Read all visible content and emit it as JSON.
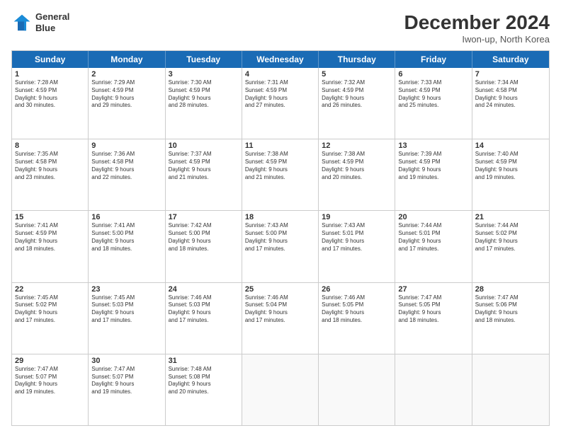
{
  "header": {
    "logo_line1": "General",
    "logo_line2": "Blue",
    "month_title": "December 2024",
    "location": "Iwon-up, North Korea"
  },
  "days_of_week": [
    "Sunday",
    "Monday",
    "Tuesday",
    "Wednesday",
    "Thursday",
    "Friday",
    "Saturday"
  ],
  "weeks": [
    [
      {
        "day": "1",
        "info": "Sunrise: 7:28 AM\nSunset: 4:59 PM\nDaylight: 9 hours\nand 30 minutes."
      },
      {
        "day": "2",
        "info": "Sunrise: 7:29 AM\nSunset: 4:59 PM\nDaylight: 9 hours\nand 29 minutes."
      },
      {
        "day": "3",
        "info": "Sunrise: 7:30 AM\nSunset: 4:59 PM\nDaylight: 9 hours\nand 28 minutes."
      },
      {
        "day": "4",
        "info": "Sunrise: 7:31 AM\nSunset: 4:59 PM\nDaylight: 9 hours\nand 27 minutes."
      },
      {
        "day": "5",
        "info": "Sunrise: 7:32 AM\nSunset: 4:59 PM\nDaylight: 9 hours\nand 26 minutes."
      },
      {
        "day": "6",
        "info": "Sunrise: 7:33 AM\nSunset: 4:59 PM\nDaylight: 9 hours\nand 25 minutes."
      },
      {
        "day": "7",
        "info": "Sunrise: 7:34 AM\nSunset: 4:58 PM\nDaylight: 9 hours\nand 24 minutes."
      }
    ],
    [
      {
        "day": "8",
        "info": "Sunrise: 7:35 AM\nSunset: 4:58 PM\nDaylight: 9 hours\nand 23 minutes."
      },
      {
        "day": "9",
        "info": "Sunrise: 7:36 AM\nSunset: 4:58 PM\nDaylight: 9 hours\nand 22 minutes."
      },
      {
        "day": "10",
        "info": "Sunrise: 7:37 AM\nSunset: 4:59 PM\nDaylight: 9 hours\nand 21 minutes."
      },
      {
        "day": "11",
        "info": "Sunrise: 7:38 AM\nSunset: 4:59 PM\nDaylight: 9 hours\nand 21 minutes."
      },
      {
        "day": "12",
        "info": "Sunrise: 7:38 AM\nSunset: 4:59 PM\nDaylight: 9 hours\nand 20 minutes."
      },
      {
        "day": "13",
        "info": "Sunrise: 7:39 AM\nSunset: 4:59 PM\nDaylight: 9 hours\nand 19 minutes."
      },
      {
        "day": "14",
        "info": "Sunrise: 7:40 AM\nSunset: 4:59 PM\nDaylight: 9 hours\nand 19 minutes."
      }
    ],
    [
      {
        "day": "15",
        "info": "Sunrise: 7:41 AM\nSunset: 4:59 PM\nDaylight: 9 hours\nand 18 minutes."
      },
      {
        "day": "16",
        "info": "Sunrise: 7:41 AM\nSunset: 5:00 PM\nDaylight: 9 hours\nand 18 minutes."
      },
      {
        "day": "17",
        "info": "Sunrise: 7:42 AM\nSunset: 5:00 PM\nDaylight: 9 hours\nand 18 minutes."
      },
      {
        "day": "18",
        "info": "Sunrise: 7:43 AM\nSunset: 5:00 PM\nDaylight: 9 hours\nand 17 minutes."
      },
      {
        "day": "19",
        "info": "Sunrise: 7:43 AM\nSunset: 5:01 PM\nDaylight: 9 hours\nand 17 minutes."
      },
      {
        "day": "20",
        "info": "Sunrise: 7:44 AM\nSunset: 5:01 PM\nDaylight: 9 hours\nand 17 minutes."
      },
      {
        "day": "21",
        "info": "Sunrise: 7:44 AM\nSunset: 5:02 PM\nDaylight: 9 hours\nand 17 minutes."
      }
    ],
    [
      {
        "day": "22",
        "info": "Sunrise: 7:45 AM\nSunset: 5:02 PM\nDaylight: 9 hours\nand 17 minutes."
      },
      {
        "day": "23",
        "info": "Sunrise: 7:45 AM\nSunset: 5:03 PM\nDaylight: 9 hours\nand 17 minutes."
      },
      {
        "day": "24",
        "info": "Sunrise: 7:46 AM\nSunset: 5:03 PM\nDaylight: 9 hours\nand 17 minutes."
      },
      {
        "day": "25",
        "info": "Sunrise: 7:46 AM\nSunset: 5:04 PM\nDaylight: 9 hours\nand 17 minutes."
      },
      {
        "day": "26",
        "info": "Sunrise: 7:46 AM\nSunset: 5:05 PM\nDaylight: 9 hours\nand 18 minutes."
      },
      {
        "day": "27",
        "info": "Sunrise: 7:47 AM\nSunset: 5:05 PM\nDaylight: 9 hours\nand 18 minutes."
      },
      {
        "day": "28",
        "info": "Sunrise: 7:47 AM\nSunset: 5:06 PM\nDaylight: 9 hours\nand 18 minutes."
      }
    ],
    [
      {
        "day": "29",
        "info": "Sunrise: 7:47 AM\nSunset: 5:07 PM\nDaylight: 9 hours\nand 19 minutes."
      },
      {
        "day": "30",
        "info": "Sunrise: 7:47 AM\nSunset: 5:07 PM\nDaylight: 9 hours\nand 19 minutes."
      },
      {
        "day": "31",
        "info": "Sunrise: 7:48 AM\nSunset: 5:08 PM\nDaylight: 9 hours\nand 20 minutes."
      },
      {
        "day": "",
        "info": ""
      },
      {
        "day": "",
        "info": ""
      },
      {
        "day": "",
        "info": ""
      },
      {
        "day": "",
        "info": ""
      }
    ]
  ]
}
